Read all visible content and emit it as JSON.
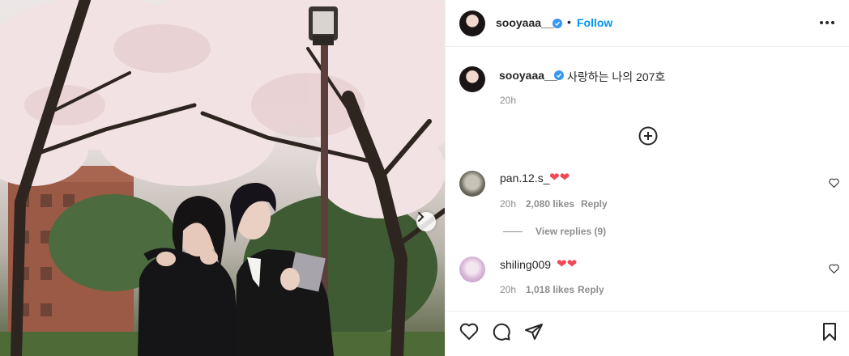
{
  "post": {
    "username": "sooyaaa__",
    "follow_label": "Follow",
    "separator": "•",
    "caption": "사랑하는 나의 207호",
    "time": "20h"
  },
  "comments": [
    {
      "username": "pan.12.s_",
      "emoji": "❤❤",
      "time": "20h",
      "likes": "2,080 likes",
      "reply": "Reply",
      "view_replies": "View replies (9)"
    },
    {
      "username": "shiling009",
      "emoji": "❤❤",
      "time": "20h",
      "likes": "1,018 likes",
      "reply": "Reply"
    }
  ],
  "icons": {
    "verified": "verified-badge-icon",
    "more": "more-options-icon",
    "load_more": "plus-circle-icon",
    "like": "heart-icon",
    "comment": "comment-icon",
    "share": "send-icon",
    "save": "bookmark-icon",
    "next": "chevron-right-icon"
  },
  "colors": {
    "accent": "#0095f6",
    "verified": "#3897f0",
    "heart": "#ed4956",
    "muted": "#8e8e8e"
  }
}
